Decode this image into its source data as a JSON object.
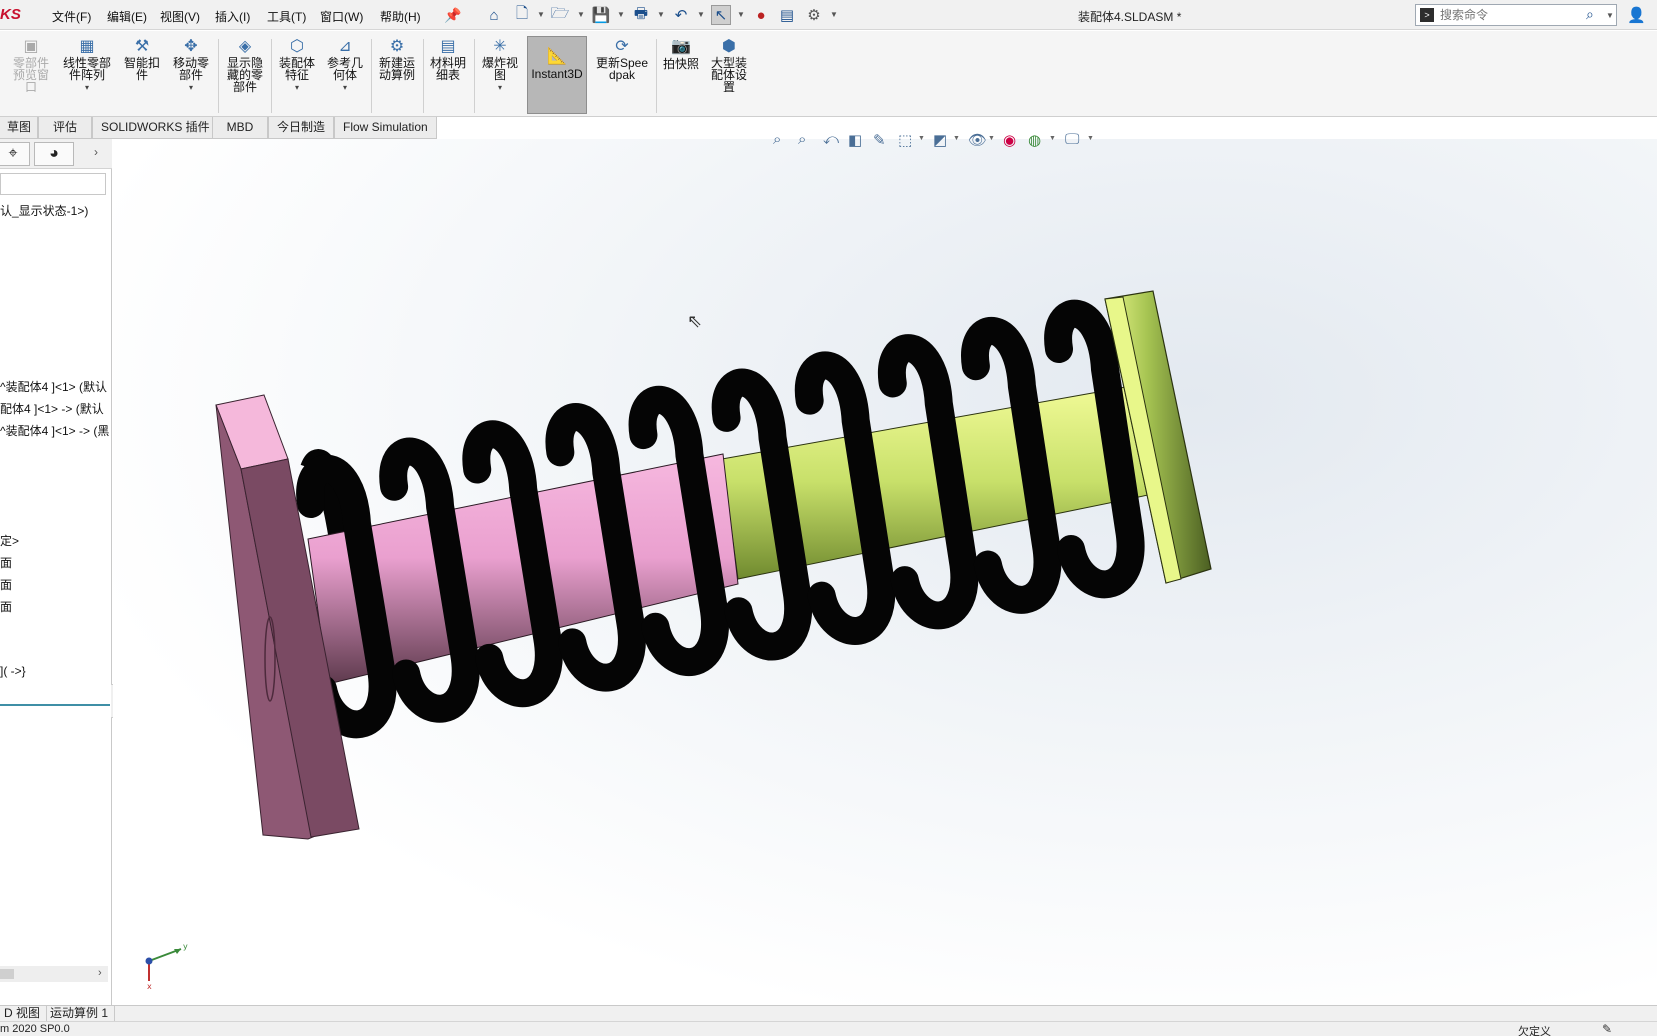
{
  "app": {
    "brand": "KS",
    "document_title": "装配体4.SLDASM *"
  },
  "menu": [
    "文件(F)",
    "编辑(E)",
    "视图(V)",
    "插入(I)",
    "工具(T)",
    "窗口(W)",
    "帮助(H)"
  ],
  "quick_access": [
    "home-icon",
    "new-file-icon",
    "open-folder-icon",
    "save-icon",
    "print-icon",
    "undo-icon",
    "select-arrow-icon",
    "traffic-light-icon",
    "file-properties-icon",
    "options-gear-icon"
  ],
  "search": {
    "placeholder": "搜索命令"
  },
  "ribbon": {
    "preview_window": "零部件预览窗口",
    "linear_pattern": "线性零部件阵列",
    "smart_fasteners": "智能扣件",
    "move_component": "移动零部件",
    "show_hidden": "显示隐藏的零部件",
    "assembly_features": "装配体特征",
    "reference_geometry": "参考几何体",
    "new_motion_study": "新建运动算例",
    "bom": "材料明细表",
    "exploded_view": "爆炸视图",
    "instant3d": "Instant3D",
    "update_speedpak": "更新Speedpak",
    "snapshot": "拍快照",
    "large_assembly": "大型装配体设置"
  },
  "tabs": [
    "草图",
    "评估",
    "SOLIDWORKS 插件",
    "MBD",
    "今日制造",
    "Flow Simulation"
  ],
  "tree": {
    "display_state": "认_显示状态-1>)",
    "component_1": "^装配体4 ]<1> (默认",
    "component_2": "配体4 ]<1> -> (默认",
    "component_3": "^装配体4 ]<1> -> (黑",
    "mate_label": "定>",
    "plane_1": "面",
    "plane_2": "面",
    "plane_3": "面",
    "mates": "]( ->}"
  },
  "bottom_tabs": [
    "D 视图",
    "运动算例 1"
  ],
  "status": {
    "version": "m 2020 SP0.0",
    "state": "欠定义"
  },
  "colors": {
    "pink_part": "#e9a3c9",
    "green_part": "#c8e06a",
    "spring": "#050505",
    "brand": "#c8102e"
  }
}
